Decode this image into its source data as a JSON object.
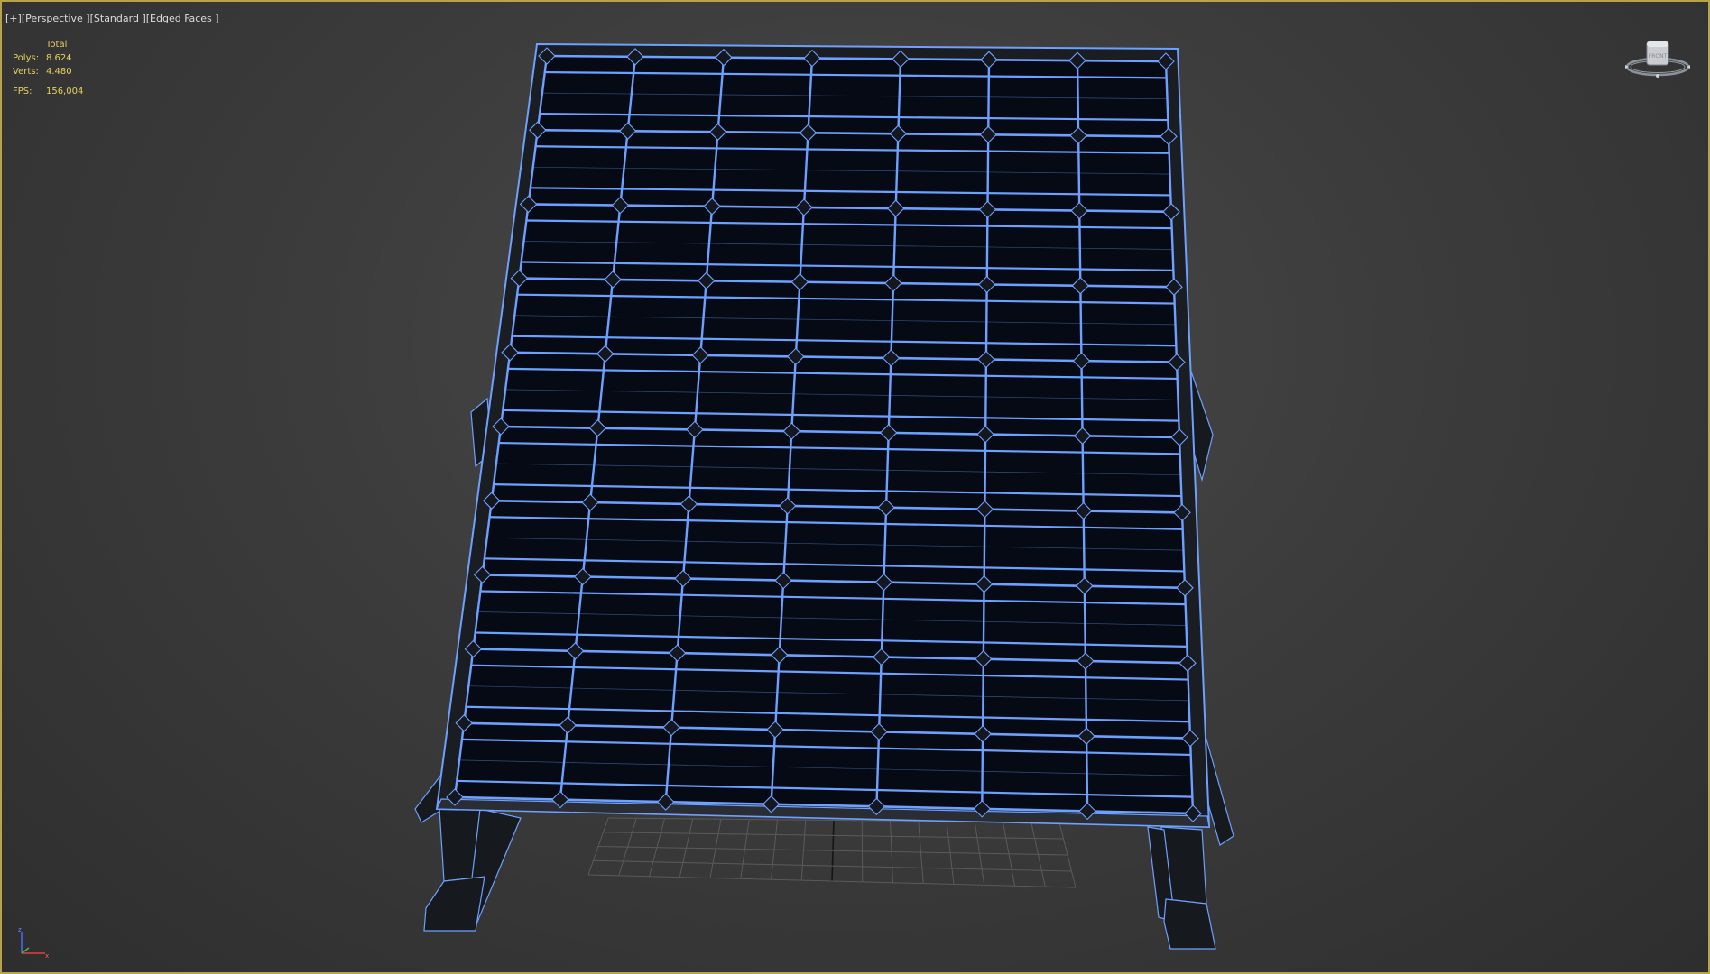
{
  "viewport": {
    "label_parts": [
      "[+]",
      "[Perspective ]",
      "[Standard ]",
      "[Edged Faces ]"
    ],
    "border_color": "#b8a24a",
    "background_color": "#3c3c3c"
  },
  "stats": {
    "header": "Total",
    "polys_label": "Polys:",
    "polys_value": "8.624",
    "verts_label": "Verts:",
    "verts_value": "4.480",
    "fps_label": "FPS:",
    "fps_value": "156,004",
    "text_color": "#e8d060"
  },
  "scene": {
    "object": "solar panel on mounting frame",
    "wire_color": "#6ea0ff",
    "cell_color": "#050a14",
    "frame_color": "#1a1d22",
    "grid_color": "#5a5a5a",
    "cell_columns": 7,
    "cell_rows": 10
  },
  "viewcube": {
    "icon": "viewcube-icon"
  },
  "axis_tripod": {
    "icon": "axis-tripod-icon",
    "labels": [
      "z",
      "x"
    ]
  }
}
